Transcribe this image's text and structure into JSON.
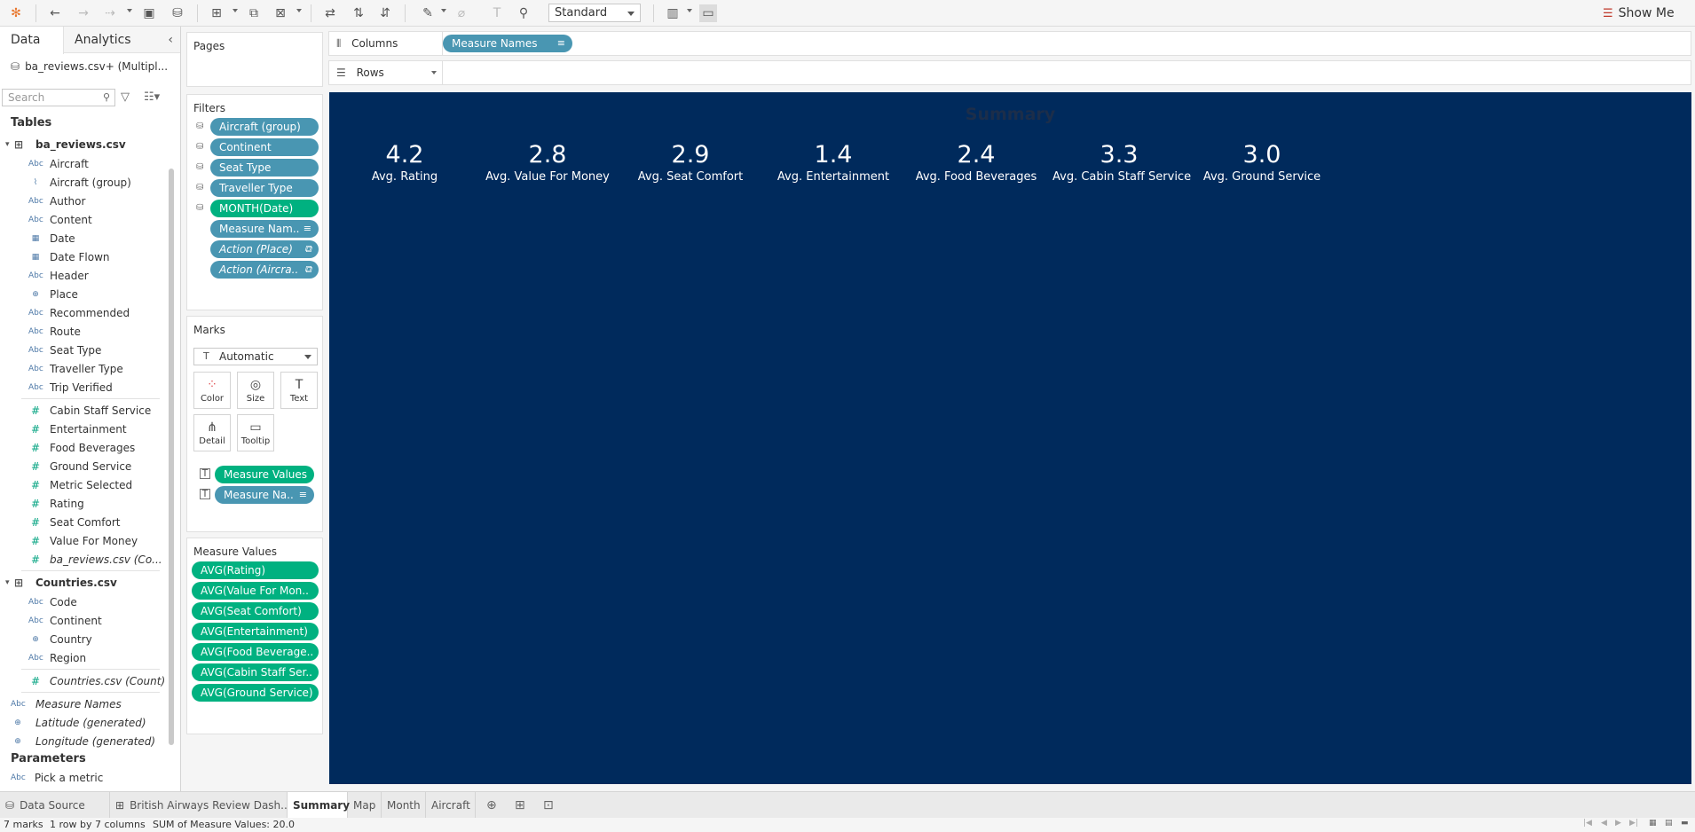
{
  "toolbar": {
    "view_mode": "Standard",
    "show_me": "Show Me"
  },
  "data_pane": {
    "tabs": [
      "Data",
      "Analytics"
    ],
    "datasource": "ba_reviews.csv+ (Multipl...",
    "search_placeholder": "Search",
    "tables_title": "Tables",
    "table1": {
      "name": "ba_reviews.csv",
      "dimensions": [
        {
          "type": "Abc",
          "label": "Aircraft"
        },
        {
          "type": "clip",
          "label": "Aircraft (group)"
        },
        {
          "type": "Abc",
          "label": "Author"
        },
        {
          "type": "Abc",
          "label": "Content"
        },
        {
          "type": "cal",
          "label": "Date"
        },
        {
          "type": "cal",
          "label": "Date Flown"
        },
        {
          "type": "Abc",
          "label": "Header"
        },
        {
          "type": "globe",
          "label": "Place"
        },
        {
          "type": "Abc",
          "label": "Recommended"
        },
        {
          "type": "Abc",
          "label": "Route"
        },
        {
          "type": "Abc",
          "label": "Seat Type"
        },
        {
          "type": "Abc",
          "label": "Traveller Type"
        },
        {
          "type": "Abc",
          "label": "Trip Verified"
        }
      ],
      "measures": [
        {
          "label": "Cabin Staff Service"
        },
        {
          "label": "Entertainment"
        },
        {
          "label": "Food Beverages"
        },
        {
          "label": "Ground Service"
        },
        {
          "label": "Metric Selected"
        },
        {
          "label": "Rating"
        },
        {
          "label": "Seat Comfort"
        },
        {
          "label": "Value For Money"
        },
        {
          "label": "ba_reviews.csv (Co..."
        }
      ]
    },
    "table2": {
      "name": "Countries.csv",
      "dimensions": [
        {
          "type": "Abc",
          "label": "Code"
        },
        {
          "type": "Abc",
          "label": "Continent"
        },
        {
          "type": "globe",
          "label": "Country"
        },
        {
          "type": "Abc",
          "label": "Region"
        }
      ],
      "measures": [
        {
          "label": "Countries.csv (Count)"
        }
      ]
    },
    "extra_fields": [
      {
        "type": "Abc",
        "label": "Measure Names"
      },
      {
        "type": "globe",
        "label": "Latitude (generated)"
      },
      {
        "type": "globe",
        "label": "Longitude (generated)"
      }
    ],
    "parameters_title": "Parameters",
    "parameter": "Pick a metric"
  },
  "pages": {
    "title": "Pages"
  },
  "filters": {
    "title": "Filters",
    "items": [
      {
        "label": "Aircraft (group)",
        "color": "blue"
      },
      {
        "label": "Continent",
        "color": "blue"
      },
      {
        "label": "Seat Type",
        "color": "blue"
      },
      {
        "label": "Traveller Type",
        "color": "blue"
      },
      {
        "label": "MONTH(Date)",
        "color": "green"
      },
      {
        "label": "Measure Nam..",
        "color": "blue"
      },
      {
        "label": "Action (Place)",
        "color": "blue"
      },
      {
        "label": "Action (Aircra..",
        "color": "blue"
      }
    ]
  },
  "marks": {
    "title": "Marks",
    "type": "Automatic",
    "buttons": [
      "Color",
      "Size",
      "Text",
      "Detail",
      "Tooltip"
    ],
    "pills": [
      {
        "label": "Measure Values",
        "color": "green"
      },
      {
        "label": "Measure Na..",
        "color": "blue"
      }
    ]
  },
  "measure_values": {
    "title": "Measure Values",
    "items": [
      "AVG(Rating)",
      "AVG(Value For Mon..",
      "AVG(Seat Comfort)",
      "AVG(Entertainment)",
      "AVG(Food Beverage..",
      "AVG(Cabin Staff Ser..",
      "AVG(Ground Service)"
    ]
  },
  "shelves": {
    "columns_label": "Columns",
    "columns_pill": "Measure Names",
    "rows_label": "Rows"
  },
  "viz": {
    "title": "Summary",
    "background": "#002a5c",
    "kpis": [
      {
        "value": "4.2",
        "label": "Avg. Rating"
      },
      {
        "value": "2.8",
        "label": "Avg. Value For Money"
      },
      {
        "value": "2.9",
        "label": "Avg. Seat Comfort"
      },
      {
        "value": "1.4",
        "label": "Avg. Entertainment"
      },
      {
        "value": "2.4",
        "label": "Avg. Food Beverages"
      },
      {
        "value": "3.3",
        "label": "Avg. Cabin Staff Service"
      },
      {
        "value": "3.0",
        "label": "Avg. Ground Service"
      }
    ]
  },
  "sheet_tabs": {
    "data_source": "Data Source",
    "dashboard": "British Airways Review Dash...",
    "sheets": [
      "Summary",
      "Map",
      "Month",
      "Aircraft"
    ],
    "active": "Summary"
  },
  "status": {
    "marks": "7 marks",
    "dims": "1 row by 7 columns",
    "sum": "SUM of Measure Values: 20.0"
  }
}
